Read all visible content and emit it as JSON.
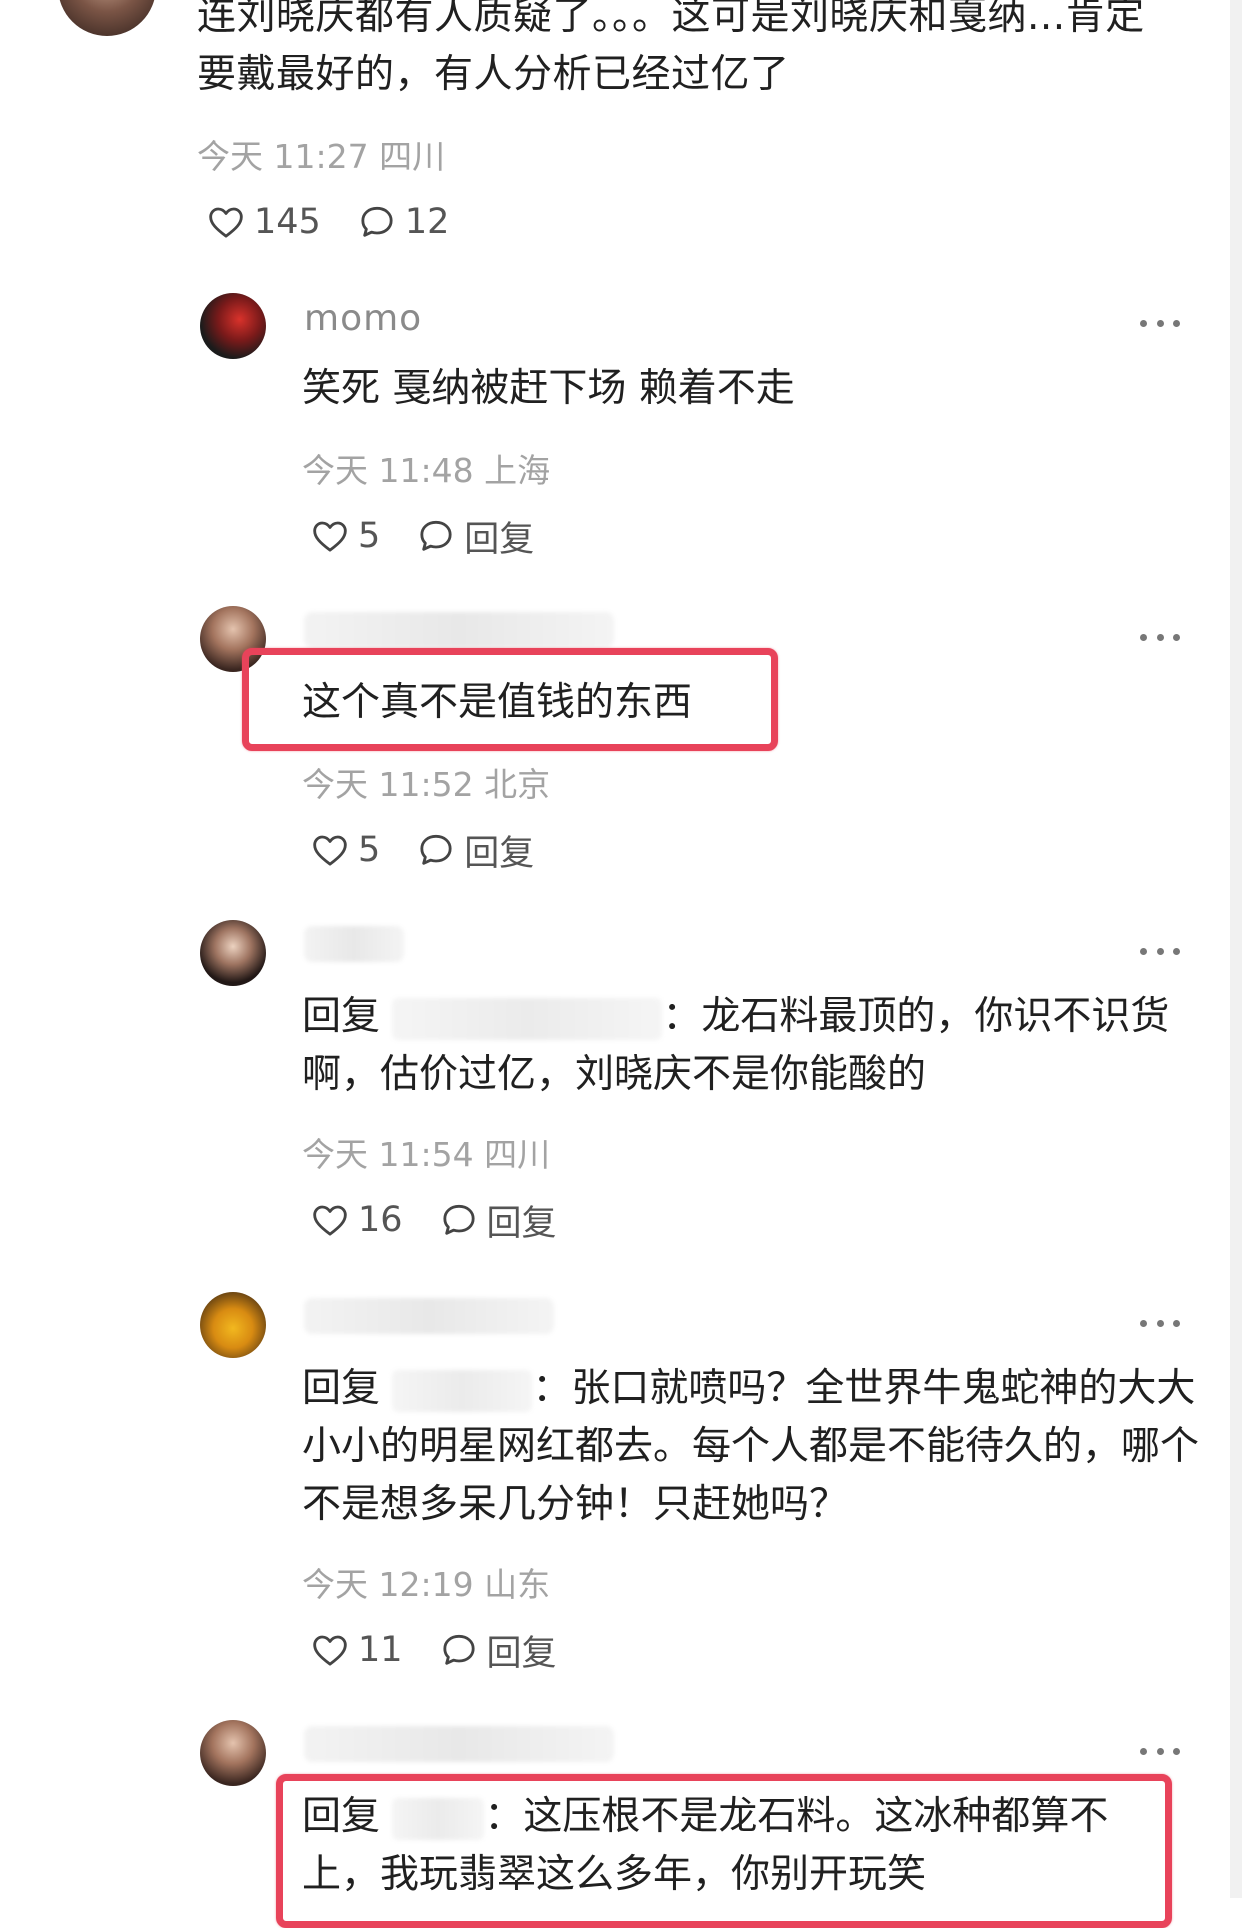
{
  "colors": {
    "highlight": "#e8435a",
    "meta_text": "#a3a3a3",
    "body_text": "#202020"
  },
  "top_comment": {
    "text": "连刘晓庆都有人质疑了。。。这可是刘晓庆和戛纳...肯定要戴最好的，有人分析已经过亿了",
    "meta": "今天 11:27 四川",
    "likes": "145",
    "replies": "12",
    "like_icon": "heart-outline-icon",
    "reply_icon": "speech-bubble-icon"
  },
  "comments": [
    {
      "username": "momo",
      "text": "笑死 戛纳被赶下场 赖着不走",
      "meta": "今天 11:48 上海",
      "likes": "5",
      "reply_label": "回复"
    },
    {
      "username": "",
      "text": "这个真不是值钱的东西",
      "meta": "今天 11:52 北京",
      "likes": "5",
      "reply_label": "回复",
      "highlighted": true
    },
    {
      "username": "",
      "reply_prefix": "回复",
      "text": "：龙石料最顶的，你识不识货啊，估价过亿，刘晓庆不是你能酸的",
      "meta": "今天 11:54 四川",
      "likes": "16",
      "reply_label": "回复"
    },
    {
      "username": "",
      "reply_prefix": "回复",
      "text": "：张口就喷吗？全世界牛鬼蛇神的大大小小的明星网红都去。每个人都是不能待久的，哪个不是想多呆几分钟！只赶她吗？",
      "meta": "今天 12:19 山东",
      "likes": "11",
      "reply_label": "回复"
    },
    {
      "username": "",
      "reply_prefix": "回复",
      "text": "：这压根不是龙石料。这冰种都算不上，我玩翡翠这么多年，你别开玩笑",
      "highlighted": true
    }
  ]
}
